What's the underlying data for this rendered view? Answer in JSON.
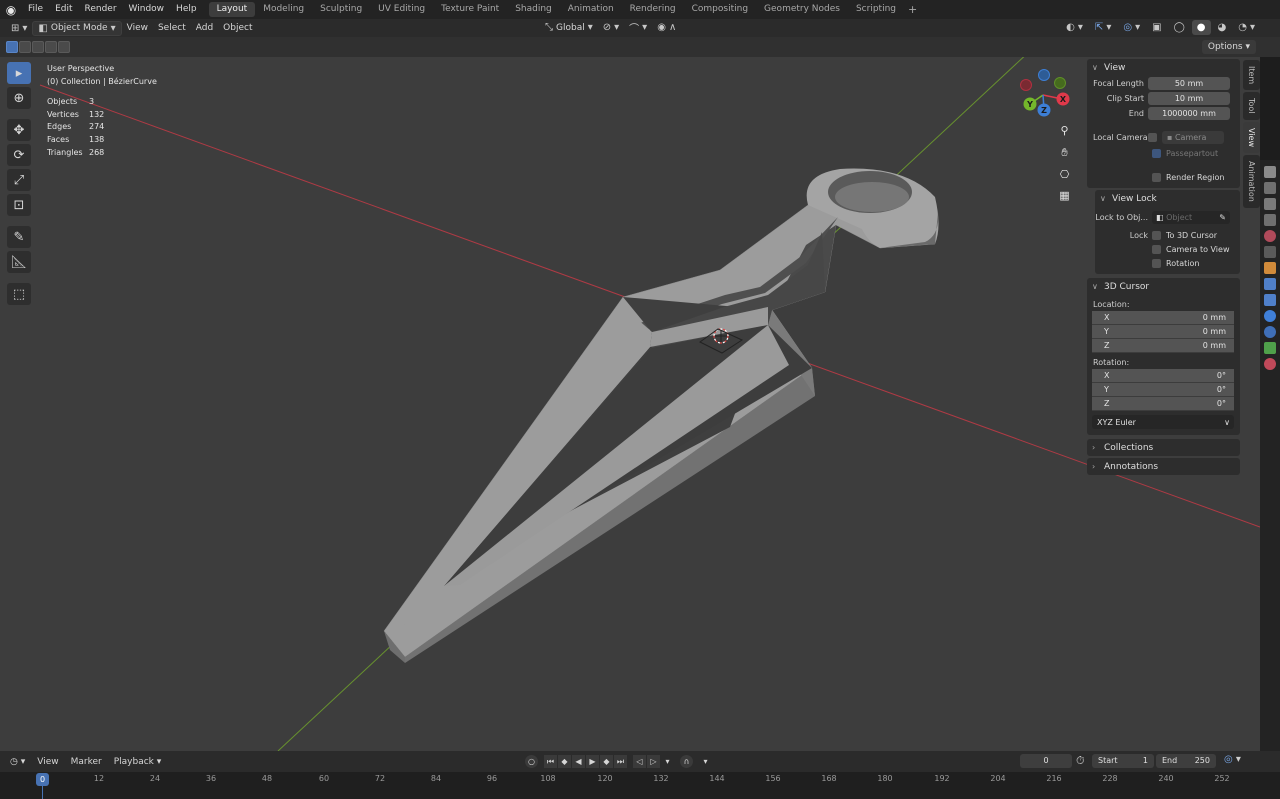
{
  "topbar": {
    "menus": [
      "File",
      "Edit",
      "Render",
      "Window",
      "Help"
    ],
    "workspaces": [
      "Layout",
      "Modeling",
      "Sculpting",
      "UV Editing",
      "Texture Paint",
      "Shading",
      "Animation",
      "Rendering",
      "Compositing",
      "Geometry Nodes",
      "Scripting"
    ],
    "active_workspace": "Layout",
    "add_tab": "+"
  },
  "viewport_header": {
    "mode": "Object Mode",
    "menus": [
      "View",
      "Select",
      "Add",
      "Object"
    ],
    "orientation": "Global",
    "options_label": "Options"
  },
  "overlay": {
    "perspective": "User Perspective",
    "collection": "(0) Collection | BézierCurve",
    "stats": [
      {
        "label": "Objects",
        "value": "3"
      },
      {
        "label": "Vertices",
        "value": "132"
      },
      {
        "label": "Edges",
        "value": "274"
      },
      {
        "label": "Faces",
        "value": "138"
      },
      {
        "label": "Triangles",
        "value": "268"
      }
    ]
  },
  "gizmo": {
    "x": "X",
    "y": "Y",
    "z": "Z"
  },
  "npanel": {
    "view_header": "View",
    "focal_length_label": "Focal Length",
    "focal_length": "50 mm",
    "clip_start_label": "Clip Start",
    "clip_start": "10 mm",
    "end_label": "End",
    "end": "1000000 mm",
    "local_camera_label": "Local Camera",
    "camera_field": "Camera",
    "passepartout": "Passepartout",
    "render_region": "Render Region",
    "view_lock_header": "View Lock",
    "lock_to_obj_label": "Lock to Obj...",
    "lock_to_obj_placeholder": "Object",
    "lock_label": "Lock",
    "to_3d_cursor": "To 3D Cursor",
    "camera_to_view": "Camera to View",
    "rotation_check": "Rotation",
    "cursor_header": "3D Cursor",
    "location_label": "Location:",
    "location": [
      {
        "axis": "X",
        "value": "0 mm"
      },
      {
        "axis": "Y",
        "value": "0 mm"
      },
      {
        "axis": "Z",
        "value": "0 mm"
      }
    ],
    "rotation_label": "Rotation:",
    "rotation": [
      {
        "axis": "X",
        "value": "0°"
      },
      {
        "axis": "Y",
        "value": "0°"
      },
      {
        "axis": "Z",
        "value": "0°"
      }
    ],
    "rotation_mode": "XYZ Euler",
    "collections_header": "Collections",
    "annotations_header": "Annotations",
    "tabs": [
      "Item",
      "Tool",
      "View",
      "Animation"
    ],
    "active_tab": "View"
  },
  "timeline": {
    "menus": [
      "View",
      "Marker",
      "Playback"
    ],
    "current_frame": "0",
    "start_label": "Start",
    "start": "1",
    "end_label": "End",
    "end": "250",
    "ruler": [
      "0",
      "12",
      "24",
      "36",
      "48",
      "60",
      "72",
      "84",
      "96",
      "108",
      "120",
      "132",
      "144",
      "156",
      "168",
      "180",
      "192",
      "204",
      "216",
      "228",
      "240",
      "252"
    ]
  },
  "colors": {
    "accent": "#4772b3",
    "axis_x": "#e0394a",
    "axis_y": "#74b72b",
    "axis_z": "#3d7fd6",
    "mesh": "#9a9a9a",
    "viewport_bg": "#3d3d3d"
  },
  "icons": {
    "editor_type": "cube-icon",
    "transform_pivot": "link-icon",
    "snap": "magnet-icon",
    "proportional": "circle-dot-icon",
    "play": "play-icon"
  }
}
